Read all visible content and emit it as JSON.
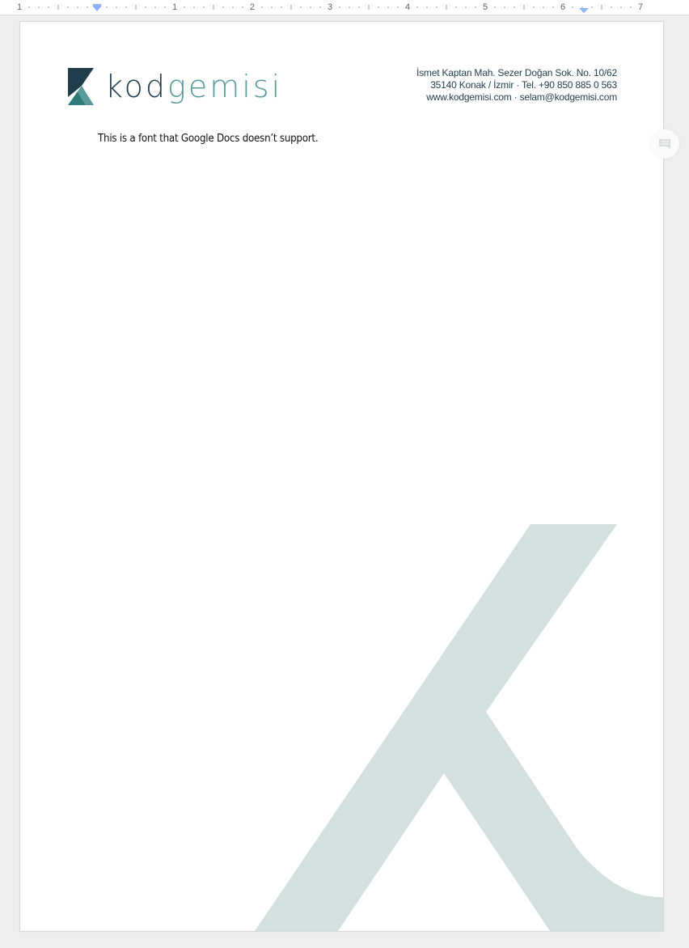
{
  "ruler": {
    "numbers": [
      "1",
      "1",
      "2",
      "3",
      "4",
      "5",
      "6",
      "7"
    ]
  },
  "letterhead": {
    "logo_kod": "kod",
    "logo_gemisi": "gemisi",
    "address_line1": "İsmet Kaptan Mah. Sezer Doğan Sok. No. 10/62",
    "address_line2": "35140 Konak / İzmir · Tel. +90 850 885 0 563",
    "address_line3": "www.kodgemisi.com · selam@kodgemisi.com"
  },
  "document": {
    "body_text": "This is a font that Google Docs doesn’t support."
  },
  "colors": {
    "brand_dark": "#1f3d4c",
    "brand_teal": "#5a9a9a",
    "watermark": "#d4e0de"
  },
  "icons": {
    "comment": "add-comment-icon"
  }
}
